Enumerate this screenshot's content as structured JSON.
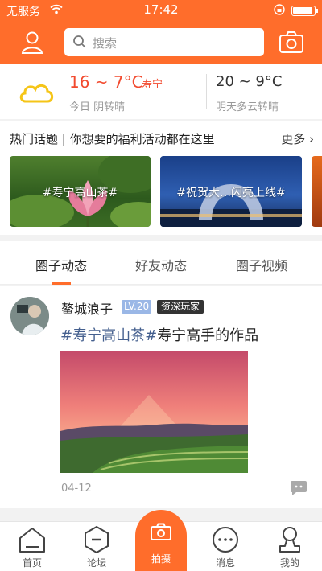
{
  "status_bar": {
    "carrier": "无服务",
    "time": "17:42"
  },
  "header": {
    "search_placeholder": "搜索"
  },
  "weather": {
    "today_temp": "16 ~ 7°C",
    "city": "寿宁",
    "today_desc": "今日 阴转晴",
    "tomorrow_temp": "20 ~ 9°C",
    "tomorrow_desc": "明天多云转晴"
  },
  "topics": {
    "title": "热门话题 | 你想要的福利活动都在这里",
    "more": "更多",
    "cards": [
      {
        "caption": "#寿宁高山茶#"
      },
      {
        "caption": "#祝贺大…闪亮上线#"
      }
    ]
  },
  "tabs": [
    {
      "label": "圈子动态"
    },
    {
      "label": "好友动态"
    },
    {
      "label": "圈子视频"
    }
  ],
  "post": {
    "username": "鳌城浪子",
    "level": "LV.20",
    "rank": "资深玩家",
    "tag": "#寿宁高山茶#",
    "text": "寿宁高手的作品",
    "date": "04-12"
  },
  "nav": {
    "home": "首页",
    "forum": "论坛",
    "shoot": "拍摄",
    "messages": "消息",
    "mine": "我的"
  },
  "colors": {
    "brand": "#ff6d2b",
    "temp_red": "#f24a2e",
    "tag_blue": "#45608f"
  }
}
